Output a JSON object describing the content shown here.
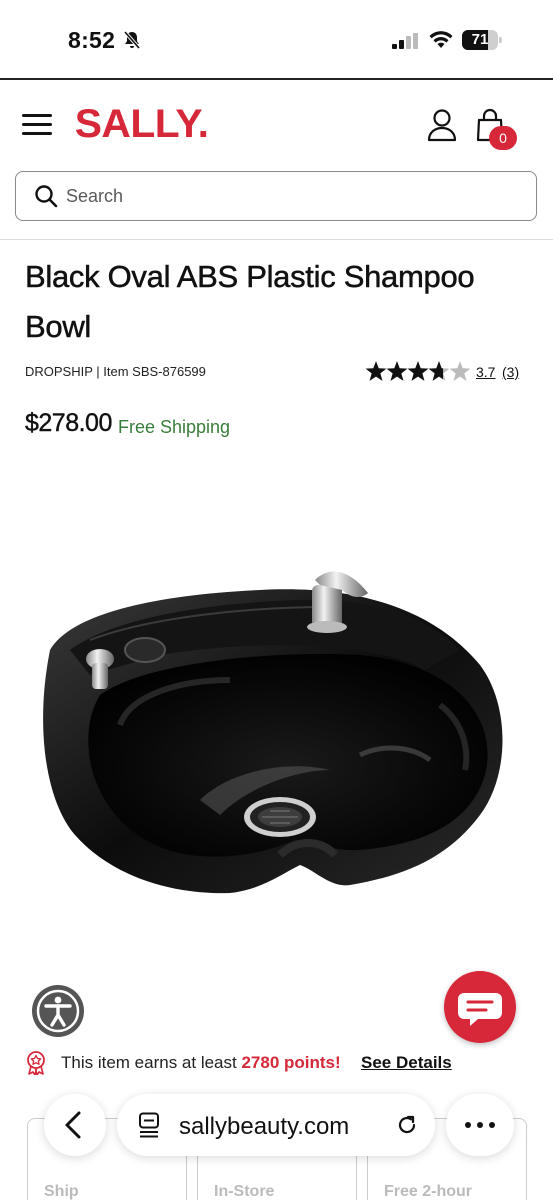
{
  "status_bar": {
    "time": "8:52",
    "battery_level": "71",
    "battery_fraction": 0.71
  },
  "header": {
    "logo": "SALLY.",
    "cart_count": "0",
    "brand_color": "#d62839",
    "search": {
      "placeholder": "Search"
    }
  },
  "product": {
    "title": "Black Oval ABS Plastic Shampoo Bowl",
    "meta": "DROPSHIP | Item SBS-876599",
    "rating": {
      "value": "3.7",
      "count": "(3)",
      "stars": 3.7,
      "max": 5
    },
    "price": "$278.00",
    "shipping": "Free Shipping",
    "shipping_color": "#3b7d3b"
  },
  "points": {
    "prefix": "This item earns at least ",
    "value": "2780 points!",
    "link": "See Details"
  },
  "fulfillment": [
    "Ship",
    "In-Store",
    "Free 2-hour"
  ],
  "browser": {
    "url": "sallybeauty.com"
  },
  "icons": {
    "menu": "hamburger-menu-icon",
    "account": "account-icon",
    "bag": "shopping-bag-icon",
    "search": "search-icon",
    "accessibility": "accessibility-icon",
    "chat": "chat-icon",
    "points": "award-badge-icon",
    "back": "chevron-left-icon",
    "site_settings": "page-settings-icon",
    "reload": "reload-icon",
    "more": "more-icon"
  }
}
